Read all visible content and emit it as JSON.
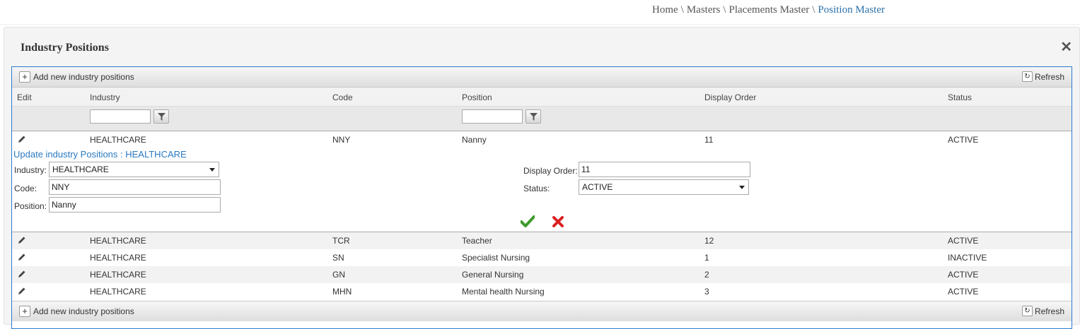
{
  "breadcrumb": {
    "items": [
      "Home",
      "Masters",
      "Placements Master"
    ],
    "separator": "\\",
    "current": "Position Master"
  },
  "panel": {
    "title": "Industry Positions",
    "close_icon": "close-icon"
  },
  "toolbar": {
    "add_label": "Add new industry positions",
    "refresh_label": "Refresh"
  },
  "columns": [
    "Edit",
    "Industry",
    "Code",
    "Position",
    "Display Order",
    "Status"
  ],
  "filters": {
    "industry": "",
    "position": ""
  },
  "edited_row": {
    "industry": "HEALTHCARE",
    "code": "NNY",
    "position": "Nanny",
    "order": "11",
    "status": "ACTIVE"
  },
  "edit_form": {
    "title": "Update industry Positions : HEALTHCARE",
    "industry_label": "Industry:",
    "industry_value": "HEALTHCARE",
    "code_label": "Code:",
    "code_value": "NNY",
    "position_label": "Position:",
    "position_value": "Nanny",
    "order_label": "Display Order:",
    "order_value": "11",
    "status_label": "Status:",
    "status_value": "ACTIVE"
  },
  "rows": [
    {
      "industry": "HEALTHCARE",
      "code": "TCR",
      "position": "Teacher",
      "order": "12",
      "status": "ACTIVE"
    },
    {
      "industry": "HEALTHCARE",
      "code": "SN",
      "position": "Specialist Nursing",
      "order": "1",
      "status": "INACTIVE"
    },
    {
      "industry": "HEALTHCARE",
      "code": "GN",
      "position": "General Nursing",
      "order": "2",
      "status": "ACTIVE"
    },
    {
      "industry": "HEALTHCARE",
      "code": "MHN",
      "position": "Mental health Nursing",
      "order": "3",
      "status": "ACTIVE"
    }
  ],
  "colors": {
    "accent": "#2a6fa8",
    "grid_border": "#2b7bd0",
    "save": "#3c9a2a",
    "cancel": "#d92020"
  }
}
